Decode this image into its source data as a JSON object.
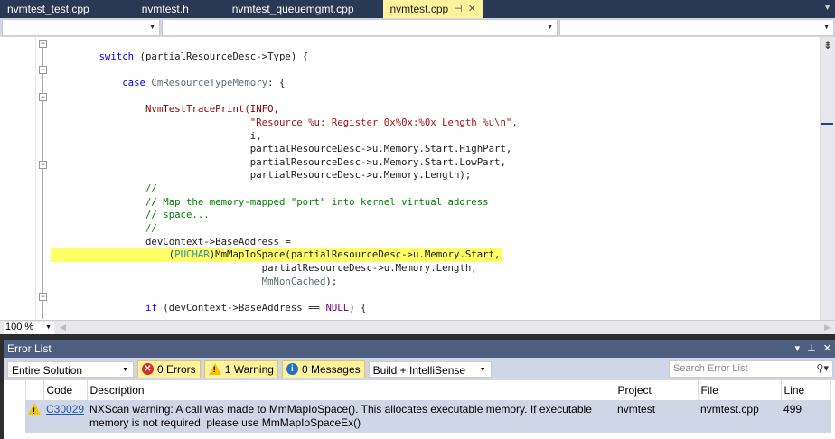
{
  "tabs": [
    {
      "label": "nvmtest_test.cpp"
    },
    {
      "label": "nvmtest.h"
    },
    {
      "label": "nvmtest_queuemgmt.cpp"
    },
    {
      "label": "nvmtest.cpp",
      "active": true
    }
  ],
  "tab_pin": "⊣",
  "tab_close": "✕",
  "code": {
    "l1": "switch",
    "l1b": " (partialResourceDesc->Type) {",
    "l2": "case",
    "l2b": " CmResourceTypeMemory",
    "l2c": ": {",
    "l3": "NvmTestTracePrint(INFO,",
    "l4": "\"Resource %u: Register 0x%0x:%0x Length %u\\n\"",
    "l5": ",",
    "l6": "i,",
    "l7": "partialResourceDesc->u.Memory.Start.HighPart,",
    "l8": "partialResourceDesc->u.Memory.Start.LowPart,",
    "l9": "partialResourceDesc->u.Memory.Length);",
    "c1": "//",
    "c2": "// Map the memory-mapped \"port\" into kernel virtual address",
    "c3": "// space...",
    "c4": "//",
    "l10": "devContext->BaseAddress =",
    "l11a": "(",
    "l11b": "PUCHAR",
    "l11c": ")MmMapIoSpace(partialResourceDesc->u.Memory.Start,",
    "l12": "partialResourceDesc->u.Memory.Length,",
    "l13a": "MmNonCached",
    "l13b": ");",
    "l14a": "if",
    "l14b": " (devContext->BaseAddress == ",
    "l14c": "NULL",
    "l14d": ") {"
  },
  "zoom": "100 %",
  "errorlist": {
    "title": "Error List",
    "scope": "Entire Solution",
    "errors": "0 Errors",
    "warnings": "1 Warning",
    "messages": "0 Messages",
    "build": "Build + IntelliSense",
    "search_placeholder": "Search Error List",
    "columns": {
      "code": "Code",
      "description": "Description",
      "project": "Project",
      "file": "File",
      "line": "Line"
    },
    "rows": [
      {
        "code": "C30029",
        "description": "NXScan warning: A call was made to MmMapIoSpace(). This allocates executable memory. If executable memory is not required, please use MmMapIoSpaceEx()",
        "project": "nvmtest",
        "file": "nvmtest.cpp",
        "line": "499"
      }
    ]
  }
}
